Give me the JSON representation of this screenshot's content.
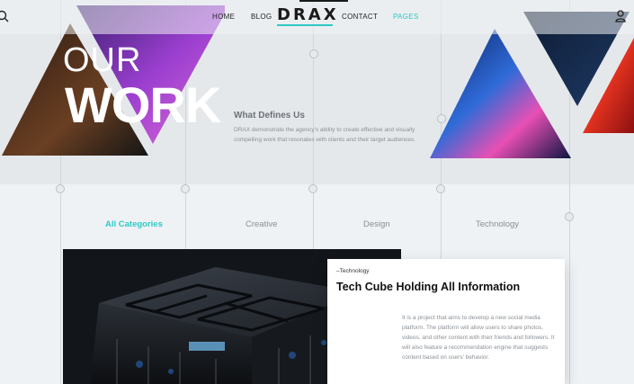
{
  "nav": {
    "home": "HOME",
    "blog": "BLOG",
    "logo": "DRAX",
    "contact": "CONTACT",
    "pages": "PAGES"
  },
  "hero": {
    "title_line1": "OUR",
    "title_line2": "WORK",
    "define_title": "What Defines Us",
    "define_text": "DRAX demonstrate the agency's ability to create effective and visually compelling work that resonates with clients and their target audiences."
  },
  "tabs": [
    "All Categories",
    "Creative",
    "Design",
    "Technology"
  ],
  "active_tab": "All Categories",
  "card": {
    "tag": "–Technology",
    "title": "Tech Cube Holding All Information",
    "description": "It is a project that aims to develop a new social media platform. The platform will allow users to share photos, videos, and other content with their friends and followers. It will also feature a recommendation engine that suggests content based on users' behavior."
  },
  "colors": {
    "accent": "#2fc9c4",
    "hero_bg": "#e5e8eb",
    "page_bg": "#eef2f5"
  },
  "icons": {
    "left": "search-icon",
    "right": "user-icon"
  }
}
